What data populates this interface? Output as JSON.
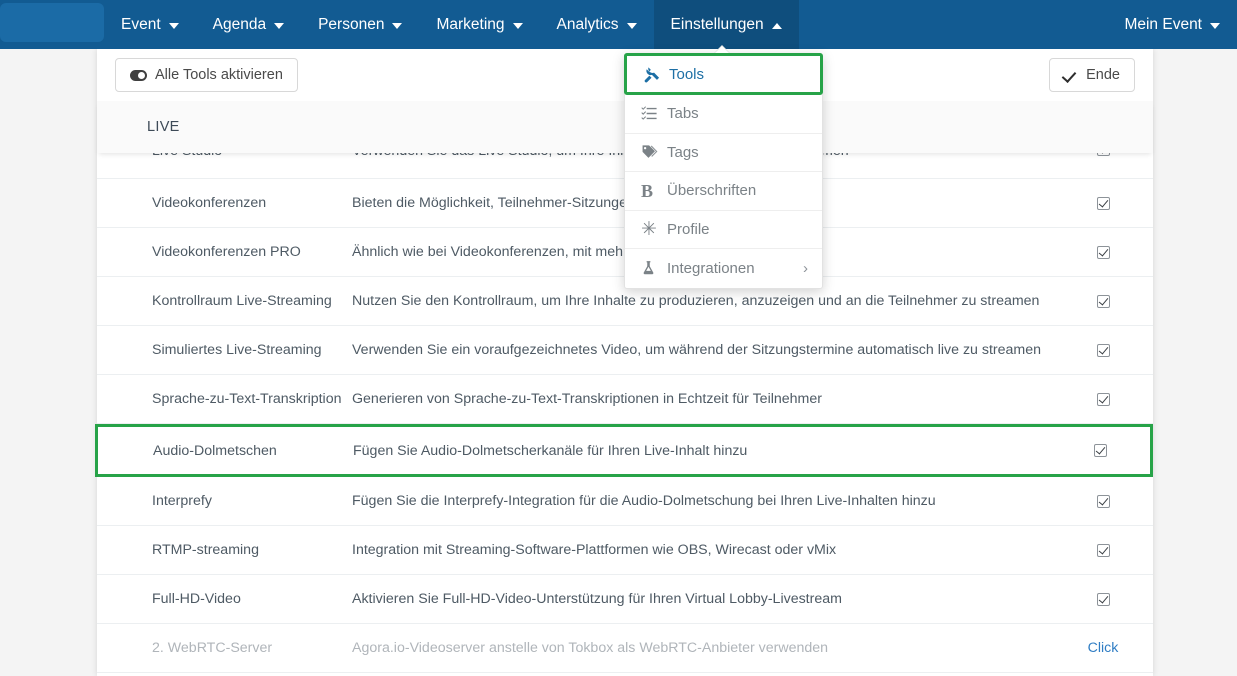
{
  "navbar": {
    "logo_name": "event-logo-placeholder",
    "items": [
      {
        "label": "Event",
        "caret": "down",
        "active": false
      },
      {
        "label": "Agenda",
        "caret": "down",
        "active": false
      },
      {
        "label": "Personen",
        "caret": "down",
        "active": false
      },
      {
        "label": "Marketing",
        "caret": "down",
        "active": false
      },
      {
        "label": "Analytics",
        "caret": "down",
        "active": false
      },
      {
        "label": "Einstellungen",
        "caret": "up",
        "active": true
      }
    ],
    "right_item": {
      "label": "Mein Event",
      "caret": "down"
    },
    "bg_color": "#125b92",
    "active_bg_color": "#0f4e7d"
  },
  "dropdown": {
    "items": [
      {
        "label": "Tools",
        "icon": "wrench-icon",
        "selected": true,
        "submenu": false
      },
      {
        "label": "Tabs",
        "icon": "list-checks-icon",
        "selected": false,
        "submenu": false
      },
      {
        "label": "Tags",
        "icon": "tags-icon",
        "selected": false,
        "submenu": false
      },
      {
        "label": "Überschriften",
        "icon": "bold-b-icon",
        "selected": false,
        "submenu": false
      },
      {
        "label": "Profile",
        "icon": "asterisk-icon",
        "selected": false,
        "submenu": false
      },
      {
        "label": "Integrationen",
        "icon": "flask-icon",
        "selected": false,
        "submenu": true
      }
    ],
    "selected_border_color": "#27a348",
    "selected_text_color": "#1d6fa5",
    "chevron_right": "›"
  },
  "toolbar": {
    "enable_all_label": "Alle Tools aktivieren",
    "enable_all_icon": "toggle-icon",
    "end_label": "Ende",
    "end_icon": "check-icon"
  },
  "section": {
    "title": "LIVE"
  },
  "table": {
    "highlight_color": "#27a348",
    "rows": [
      {
        "name": "Live Studio",
        "description": "Verwenden Sie das Live Studio, um Ihre Inhalte an die Teilnehmer zu streamen",
        "action": "checkbox",
        "checked": true,
        "state": "partial"
      },
      {
        "name": "Videokonferenzen",
        "description": "Bieten die Möglichkeit, Teilnehmer-Sitzungen zu verbinden",
        "action": "checkbox",
        "checked": true,
        "state": "normal"
      },
      {
        "name": "Videokonferenzen PRO",
        "description": "Ähnlich wie bei Videokonferenzen, mit mehr Moderatoren",
        "action": "checkbox",
        "checked": true,
        "state": "normal"
      },
      {
        "name": "Kontrollraum Live-Streaming",
        "description": "Nutzen Sie den Kontrollraum, um Ihre Inhalte zu produzieren, anzuzeigen und an die Teilnehmer zu streamen",
        "action": "checkbox",
        "checked": true,
        "state": "normal"
      },
      {
        "name": "Simuliertes Live-Streaming",
        "description": "Verwenden Sie ein voraufgezeichnetes Video, um während der Sitzungstermine automatisch live zu streamen",
        "action": "checkbox",
        "checked": true,
        "state": "normal"
      },
      {
        "name": "Sprache-zu-Text-Transkription",
        "description": "Generieren von Sprache-zu-Text-Transkriptionen in Echtzeit für Teilnehmer",
        "action": "checkbox",
        "checked": true,
        "state": "normal"
      },
      {
        "name": "Audio-Dolmetschen",
        "description": "Fügen Sie Audio-Dolmetscherkanäle für Ihren Live-Inhalt hinzu",
        "action": "checkbox",
        "checked": true,
        "state": "highlight"
      },
      {
        "name": "Interprefy",
        "description": "Fügen Sie die Interprefy-Integration für die Audio-Dolmetschung bei Ihren Live-Inhalten hinzu",
        "action": "checkbox",
        "checked": true,
        "state": "normal"
      },
      {
        "name": "RTMP-streaming",
        "description": "Integration mit Streaming-Software-Plattformen wie OBS, Wirecast oder vMix",
        "action": "checkbox",
        "checked": true,
        "state": "normal"
      },
      {
        "name": "Full-HD-Video",
        "description": "Aktivieren Sie Full-HD-Video-Unterstützung für Ihren Virtual Lobby-Livestream",
        "action": "checkbox",
        "checked": true,
        "state": "normal"
      },
      {
        "name": "2. WebRTC-Server",
        "description": "Agora.io-Videoserver anstelle von Tokbox als WebRTC-Anbieter verwenden",
        "action": "link",
        "action_label": "Click",
        "checked": false,
        "state": "muted"
      }
    ]
  }
}
